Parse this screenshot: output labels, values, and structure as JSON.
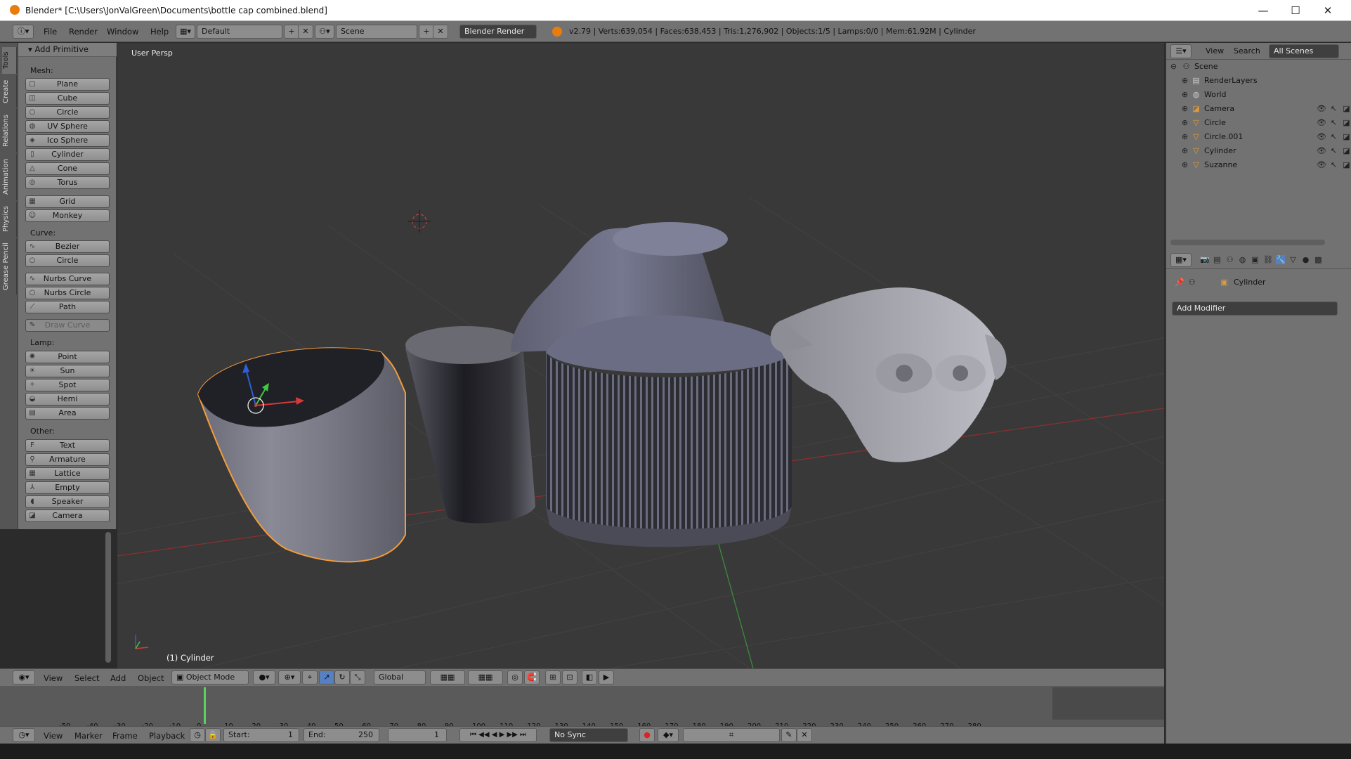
{
  "window": {
    "title": "Blender* [C:\\Users\\JonValGreen\\Documents\\bottle cap combined.blend]",
    "controls": [
      "—",
      "☐",
      "✕"
    ]
  },
  "info_header": {
    "menus": [
      "File",
      "Render",
      "Window",
      "Help"
    ],
    "layout": "Default",
    "scene": "Scene",
    "engine": "Blender Render",
    "stats": "v2.79 | Verts:639,054 | Faces:638,453 | Tris:1,276,902 | Objects:1/5 | Lamps:0/0 | Mem:61.92M | Cylinder"
  },
  "tool_tabs": [
    "Tools",
    "Create",
    "Relations",
    "Animation",
    "Physics",
    "Grease Pencil"
  ],
  "tool_shelf": {
    "panel_title": "Add Primitive",
    "sections": [
      {
        "label": "Mesh:",
        "items": [
          "Plane",
          "Cube",
          "Circle",
          "UV Sphere",
          "Ico Sphere",
          "Cylinder",
          "Cone",
          "Torus"
        ]
      },
      {
        "label": "",
        "items": [
          "Grid",
          "Monkey"
        ]
      },
      {
        "label": "Curve:",
        "items": [
          "Bezier",
          "Circle"
        ]
      },
      {
        "label": "",
        "items": [
          "Nurbs Curve",
          "Nurbs Circle",
          "Path"
        ]
      },
      {
        "label": "",
        "items": [
          "Draw Curve"
        ]
      },
      {
        "label": "Lamp:",
        "items": [
          "Point",
          "Sun",
          "Spot",
          "Hemi",
          "Area"
        ]
      },
      {
        "label": "Other:",
        "items": [
          "Text",
          "Armature",
          "Lattice",
          "Empty",
          "Speaker",
          "Camera"
        ]
      }
    ]
  },
  "viewport": {
    "view_label": "User Persp",
    "object_label": "(1) Cylinder"
  },
  "viewport_header": {
    "menus": [
      "View",
      "Select",
      "Add",
      "Object"
    ],
    "mode": "Object Mode",
    "orientation": "Global"
  },
  "timeline": {
    "ticks": [
      "-50",
      "-40",
      "-30",
      "-20",
      "-10",
      "0",
      "10",
      "20",
      "30",
      "40",
      "50",
      "60",
      "70",
      "80",
      "90",
      "100",
      "110",
      "120",
      "130",
      "140",
      "150",
      "160",
      "170",
      "180",
      "190",
      "200",
      "210",
      "220",
      "230",
      "240",
      "250",
      "260",
      "270",
      "280"
    ],
    "current_frame": 1,
    "menus": [
      "View",
      "Marker",
      "Frame",
      "Playback"
    ],
    "start_label": "Start:",
    "start": "1",
    "end_label": "End:",
    "end": "250",
    "frame": "1",
    "sync": "No Sync"
  },
  "outliner": {
    "header_items": [
      "View",
      "Search"
    ],
    "scope": "All Scenes",
    "root": "Scene",
    "items": [
      {
        "label": "RenderLayers",
        "icon": "render-layers-icon",
        "color": "#c8c8c8"
      },
      {
        "label": "World",
        "icon": "world-icon",
        "color": "#c8c8c8"
      },
      {
        "label": "Camera",
        "icon": "camera-object-icon",
        "color": "#e39a34"
      },
      {
        "label": "Circle",
        "icon": "mesh-object-icon",
        "color": "#e39a34"
      },
      {
        "label": "Circle.001",
        "icon": "mesh-object-icon",
        "color": "#e39a34"
      },
      {
        "label": "Cylinder",
        "icon": "mesh-object-icon",
        "color": "#e39a34"
      },
      {
        "label": "Suzanne",
        "icon": "mesh-object-icon",
        "color": "#e39a34"
      }
    ]
  },
  "properties": {
    "object_name": "Cylinder",
    "add_modifier": "Add Modifier"
  },
  "colors": {
    "selection_outline": "#f39c3c",
    "x_axis": "#d43a3a",
    "y_axis": "#3fc83f",
    "z_axis": "#2f5ed6",
    "frame_marker": "#5bd25b"
  }
}
